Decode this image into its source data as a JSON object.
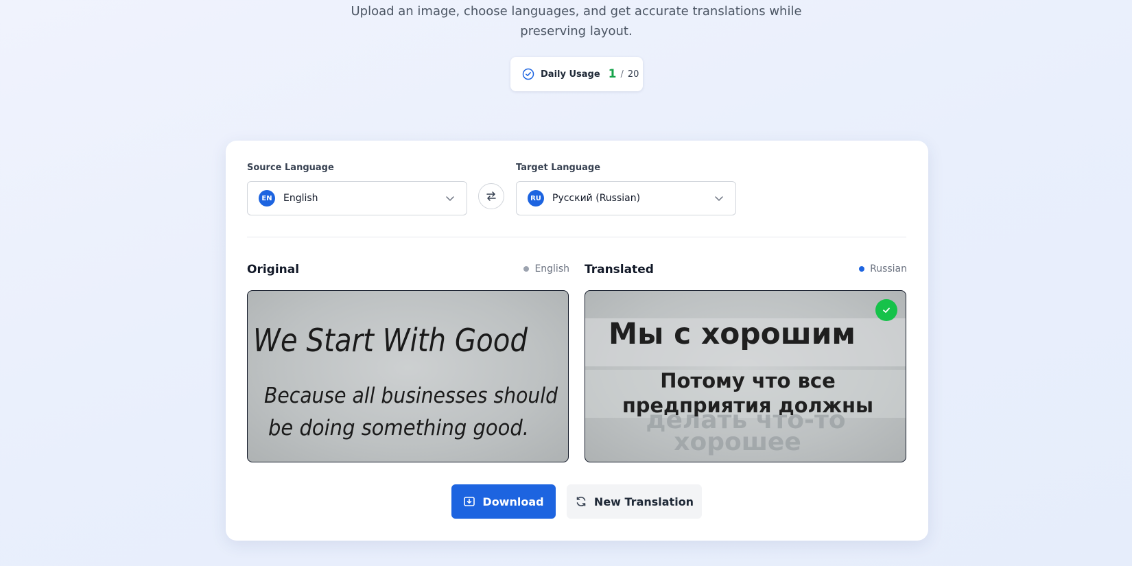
{
  "header": {
    "subtitle_line1": "Upload an image, choose languages, and get accurate translations while",
    "subtitle_line2": "preserving layout."
  },
  "usage": {
    "label": "Daily Usage",
    "used": "1",
    "separator": "/",
    "limit": "20",
    "icon": "check-circle-icon"
  },
  "languages": {
    "source_label": "Source Language",
    "source_code": "EN",
    "source_value": "English",
    "target_label": "Target Language",
    "target_code": "RU",
    "target_value": "Русский (Russian)",
    "swap_icon": "swap-arrows-icon"
  },
  "original": {
    "title": "Original",
    "language": "English",
    "image_line1": "We Start With Good",
    "image_line2": "Because all businesses should",
    "image_line3": "be doing something good."
  },
  "translated": {
    "title": "Translated",
    "language": "Russian",
    "image_line1": "Мы с хорошим",
    "image_line2": "Потому что все",
    "image_line3": "предприятия должны",
    "ghost_line1": "делать что-то",
    "ghost_line2": "хорошее"
  },
  "actions": {
    "download": "Download",
    "new_translation": "New Translation"
  },
  "colors": {
    "accent": "#1d64e0",
    "success": "#16a34a",
    "status_dot_source": "#9ca3af",
    "status_dot_target": "#1d64e0"
  }
}
